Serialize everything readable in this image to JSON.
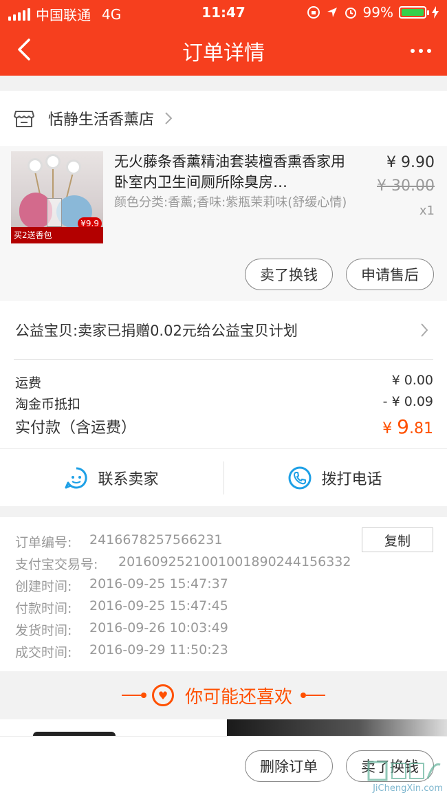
{
  "status_bar": {
    "carrier": "中国联通",
    "network": "4G",
    "time": "11:47",
    "battery": "99%",
    "battery_level": 0.99
  },
  "header": {
    "title": "订单详情"
  },
  "store": {
    "name": "恬静生活香薰店"
  },
  "item": {
    "title": "无火藤条香薰精油套装檀香熏香家用卧室内卫生间厕所除臭房…",
    "sku": "颜色分类:香薰;香味:紫瓶茉莉味(舒缓心情)",
    "price": "¥ 9.90",
    "original_price": "¥ 30.00",
    "quantity": "x1",
    "image_promo": "买2送香包",
    "image_badge": "¥9.9",
    "buttons": {
      "sell": "卖了换钱",
      "after_sale": "申请售后"
    }
  },
  "charity": {
    "text": "公益宝贝:卖家已捐赠0.02元给公益宝贝计划"
  },
  "fees": {
    "shipping_label": "运费",
    "shipping_value": "¥ 0.00",
    "coin_label": "淘金币抵扣",
    "coin_value": "- ¥ 0.09",
    "total_label": "实付款（含运费）",
    "total_currency": "¥",
    "total_int": "9",
    "total_dec": ".81"
  },
  "contact": {
    "seller": "联系卖家",
    "call": "拨打电话"
  },
  "order_info": {
    "order_no_label": "订单编号:",
    "order_no": "2416678257566231",
    "copy": "复制",
    "alipay_label": "支付宝交易号:",
    "alipay_no": "2016092521001001890244156332",
    "created_label": "创建时间:",
    "created": "2016-09-25 15:47:37",
    "paid_label": "付款时间:",
    "paid": "2016-09-25 15:47:45",
    "shipped_label": "发货时间:",
    "shipped": "2016-09-26 10:03:49",
    "closed_label": "成交时间:",
    "closed": "2016-09-29 11:50:23"
  },
  "recommend": {
    "title": "你可能还喜欢"
  },
  "bottom": {
    "delete": "删除订单",
    "sell": "卖了换钱"
  },
  "watermark": {
    "text": "JiChengXin.com"
  },
  "colors": {
    "header": "#f63f1e",
    "accent": "#ff5000",
    "contact_icon": "#1ea0e6"
  }
}
